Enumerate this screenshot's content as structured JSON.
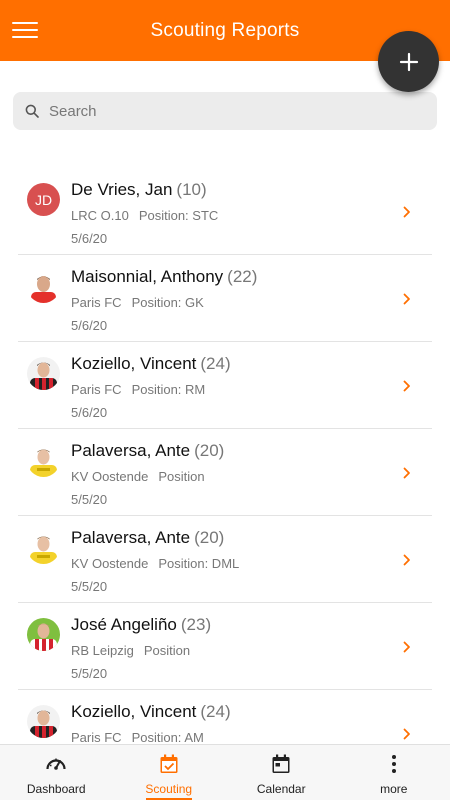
{
  "app_bar": {
    "title": "Scouting Reports",
    "menu_icon": "hamburger-menu-icon"
  },
  "fab": {
    "icon": "plus-icon"
  },
  "search": {
    "placeholder": "Search",
    "value": ""
  },
  "colors": {
    "accent": "#ff6f00",
    "fab": "#333333",
    "avatar_initials_bg": "#d85050"
  },
  "reports": [
    {
      "name": "De Vries, Jan",
      "age": "(10)",
      "club": "LRC O.10",
      "position": "Position: STC",
      "date": "5/6/20",
      "avatar": {
        "initials": "JD",
        "kit": ""
      }
    },
    {
      "name": "Maisonnial, Anthony",
      "age": "(22)",
      "club": "Paris FC",
      "position": "Position: GK",
      "date": "5/6/20",
      "avatar": {
        "initials": "",
        "kit": "red"
      }
    },
    {
      "name": "Koziello, Vincent",
      "age": "(24)",
      "club": "Paris FC",
      "position": "Position: RM",
      "date": "5/6/20",
      "avatar": {
        "initials": "",
        "kit": "red-black"
      }
    },
    {
      "name": "Palaversa, Ante",
      "age": "(20)",
      "club": "KV Oostende",
      "position": "Position",
      "date": "5/5/20",
      "avatar": {
        "initials": "",
        "kit": "yellow"
      }
    },
    {
      "name": "Palaversa, Ante",
      "age": "(20)",
      "club": "KV Oostende",
      "position": "Position: DML",
      "date": "5/5/20",
      "avatar": {
        "initials": "",
        "kit": "yellow"
      }
    },
    {
      "name": "José Angeliño",
      "age": "(23)",
      "club": "RB Leipzig",
      "position": "Position",
      "date": "5/5/20",
      "avatar": {
        "initials": "",
        "kit": "red-white"
      }
    },
    {
      "name": "Koziello, Vincent",
      "age": "(24)",
      "club": "Paris FC",
      "position": "Position: AM",
      "date": "",
      "avatar": {
        "initials": "",
        "kit": "red-black"
      }
    }
  ],
  "bottom_nav": [
    {
      "label": "Dashboard",
      "icon": "speedometer-icon",
      "active": false
    },
    {
      "label": "Scouting",
      "icon": "calendar-check-icon",
      "active": true
    },
    {
      "label": "Calendar",
      "icon": "calendar-icon",
      "active": false
    },
    {
      "label": "more",
      "icon": "more-vertical-icon",
      "active": false
    }
  ]
}
